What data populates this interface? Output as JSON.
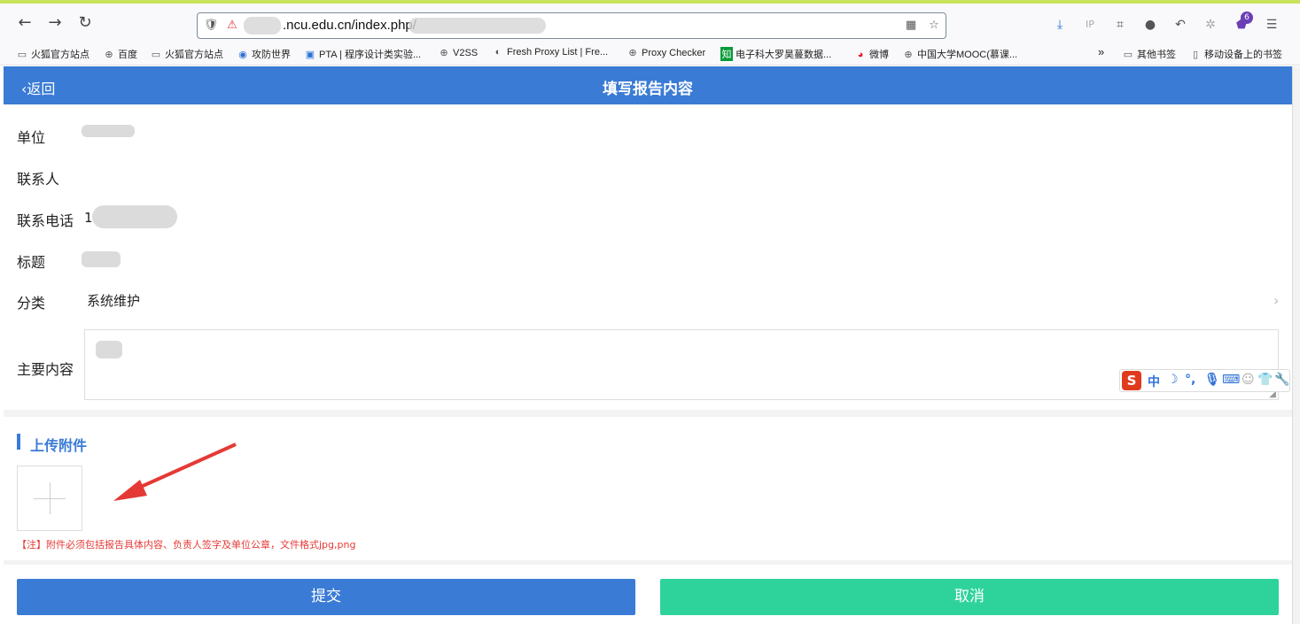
{
  "browser": {
    "url_visible": ".ncu.edu.cn/index.php/",
    "bookmarks": [
      {
        "label": "火狐官方站点",
        "icon": "folder-icon"
      },
      {
        "label": "百度",
        "icon": "globe-icon"
      },
      {
        "label": "火狐官方站点",
        "icon": "folder-icon"
      },
      {
        "label": "攻防世界",
        "icon": "site-icon"
      },
      {
        "label": "PTA | 程序设计类实验...",
        "icon": "site-icon"
      },
      {
        "label": "V2SS",
        "icon": "globe-icon"
      },
      {
        "label": "Fresh Proxy List | Fre...",
        "icon": "site-icon"
      },
      {
        "label": "Proxy Checker",
        "icon": "globe-icon"
      },
      {
        "label": "电子科大罗昊蔓数据...",
        "icon": "zhihu-icon"
      },
      {
        "label": "微博",
        "icon": "weibo-icon"
      },
      {
        "label": "中国大学MOOC(慕课...",
        "icon": "globe-icon"
      }
    ],
    "overflow": "»",
    "other_bookmarks": "其他书签",
    "mobile_bookmarks": "移动设备上的书签",
    "toolbar_badge": "6",
    "ip_label": "IP"
  },
  "header": {
    "back_label": "返回",
    "title": "填写报告内容"
  },
  "form": {
    "unit_label": "单位",
    "contact_label": "联系人",
    "phone_label": "联系电话",
    "phone_prefix": "1",
    "title_label": "标题",
    "category_label": "分类",
    "category_value": "系统维护",
    "content_label": "主要内容"
  },
  "ime": {
    "zh": "中"
  },
  "upload": {
    "section_title": "上传附件",
    "note": "【注】附件必须包括报告具体内容、负责人签字及单位公章，文件格式jpg,png"
  },
  "buttons": {
    "submit": "提交",
    "cancel": "取消"
  },
  "colors": {
    "primary": "#3a7bd5",
    "success": "#2ed39c",
    "danger": "#e53935"
  }
}
